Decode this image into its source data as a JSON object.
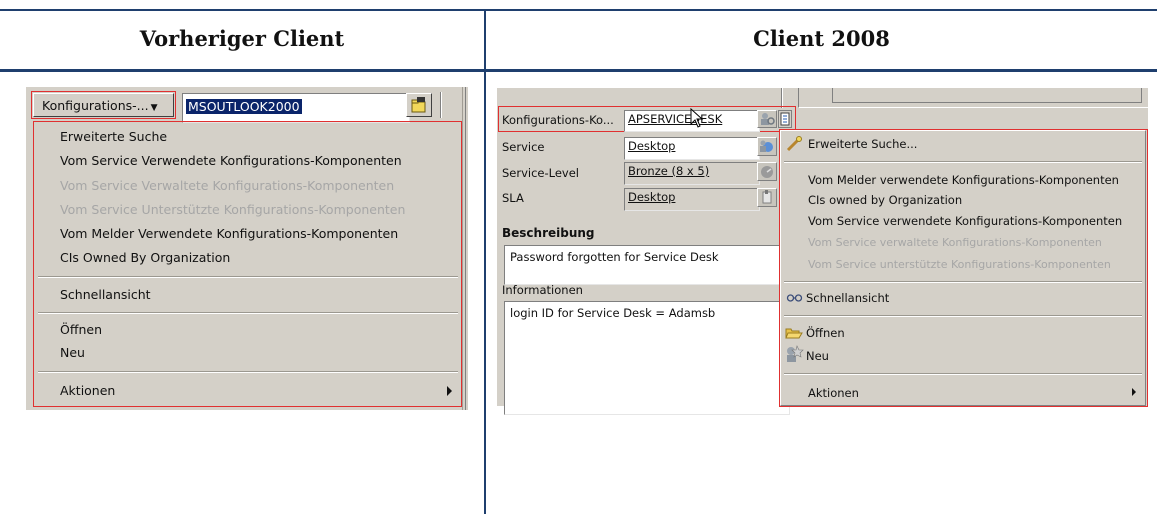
{
  "headers": {
    "left": "Vorheriger Client",
    "right": "Client 2008"
  },
  "colors": {
    "rule_blue": "#1f3f6e",
    "highlight_red": "#e03030",
    "selection_blue": "#0a246a",
    "disabled_text": "#a6a6a6"
  },
  "left_panel": {
    "config_button_label": "Konfigurations-...",
    "config_value": "MSOUTLOOK2000",
    "menu": {
      "items": [
        "Erweiterte Suche",
        "Vom Service Verwendete Konfigurations-Komponenten",
        "Vom Service Verwaltete Konfigurations-Komponenten",
        "Vom Service Unterstützte Konfigurations-Komponenten",
        "Vom Melder Verwendete Konfigurations-Komponenten",
        "CIs Owned By Organization",
        "Schnellansicht",
        "Öffnen",
        "Neu",
        "Aktionen"
      ],
      "disabled_items": [
        "Vom Service Verwaltete Konfigurations-Komponenten",
        "Vom Service Unterstützte Konfigurations-Komponenten"
      ]
    }
  },
  "right_panel": {
    "form": {
      "config_label": "Konfigurations-Ko...",
      "config_value": "APSERVICEDESK",
      "service_label": "Service",
      "service_value": "Desktop",
      "service_level_label": "Service-Level",
      "service_level_value": "Bronze (8 x 5)",
      "sla_label": "SLA",
      "sla_value": "Desktop",
      "description_label": "Beschreibung",
      "description_value": "Password forgotten for Service Desk",
      "info_label": "Informationen",
      "info_value": "login ID for Service Desk = Adamsb"
    },
    "menu": {
      "items": [
        "Erweiterte Suche...",
        "Vom Melder verwendete Konfigurations-Komponenten",
        "CIs owned by Organization",
        "Vom Service verwendete Konfigurations-Komponenten",
        "Vom Service verwaltete Konfigurations-Komponenten",
        "Vom Service unterstützte Konfigurations-Komponenten",
        "Schnellansicht",
        "Öffnen",
        "Neu",
        "Aktionen"
      ],
      "disabled_items": [
        "Vom Service verwaltete Konfigurations-Komponenten",
        "Vom Service unterstützte Konfigurations-Komponenten"
      ],
      "icons": [
        "magic-wand-icon",
        "glasses-icon",
        "folder-open-icon",
        "new-document-icon",
        "submenu-arrow-icon"
      ]
    }
  }
}
